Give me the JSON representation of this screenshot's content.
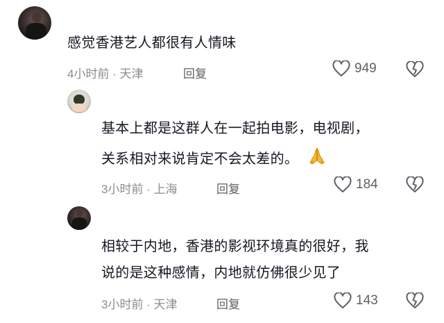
{
  "comments": [
    {
      "text": "感觉香港艺人都很有人情味",
      "time_location": "4小时前 · 天津",
      "reply_label": "回复",
      "likes": "949"
    },
    {
      "text_line1": "基本上都是这群人在一起拍电影，电视剧，",
      "text_line2": "关系相对来说肯定不会太差的。",
      "emoji": "folded-hands",
      "time_location": "3小时前 · 上海",
      "reply_label": "回复",
      "likes": "184"
    },
    {
      "text_line1": "相较于内地，香港的影视环境真的很好，我",
      "text_line2": "说的是这种感情，内地就仿佛很少见了",
      "time_location": "3小时前 · 天津",
      "reply_label": "回复",
      "likes": "143"
    }
  ],
  "colors": {
    "text": "#161823",
    "meta": "#8a8b91",
    "icon": "#5e5f66"
  }
}
